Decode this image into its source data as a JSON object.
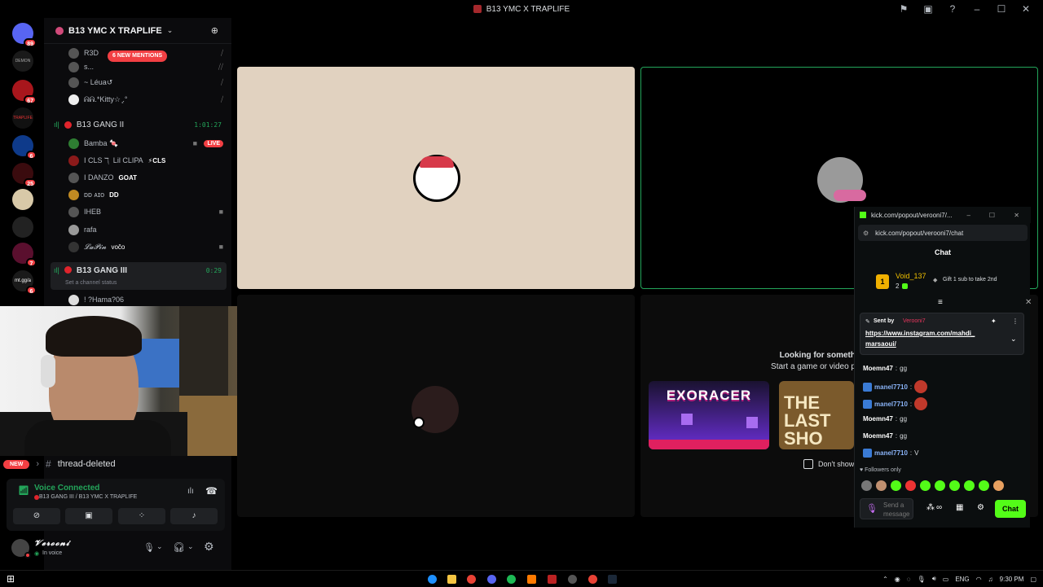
{
  "window": {
    "title": "B13 YMC X TRAPLIFE"
  },
  "servers": [
    {
      "badge": "89"
    },
    {
      "label": "DEMON"
    },
    {
      "badge": "67"
    },
    {
      "label": "TRAPLIFE"
    },
    {
      "badge": "6"
    },
    {
      "badge": "25"
    },
    {
      "badge": ""
    },
    {
      "badge": ""
    },
    {
      "badge": "7"
    },
    {
      "label": "mt.gg/a",
      "badge": "6"
    }
  ],
  "guild": {
    "name": "B13 YMC X TRAPLIFE",
    "mention_pill": "6 NEW MENTIONS"
  },
  "channel_list": {
    "top_users": [
      "R3D",
      "s...",
      "~ Léua↺",
      "ᕱᕱ.*Kitty☆ ̥.°"
    ],
    "channel1": {
      "name": "B13 GANG II",
      "timer": "1:01:27"
    },
    "channel1_users": [
      {
        "name": "Bamba 🍬",
        "badge": "LIVE"
      },
      {
        "name": "I CLS ℸ ̣ Lil CLIPA",
        "tag": "⚡CLS"
      },
      {
        "name": "I DANZO",
        "tag": "GOAT"
      },
      {
        "name": "ᴅᴅ ᴀɪᴏ",
        "tag": "DD"
      },
      {
        "name": "IHEB",
        "tag": ""
      },
      {
        "name": "rafa",
        "tag": ""
      },
      {
        "name": "𝓛𝓪𝓟𝓲𝓷",
        "tag": "vočo"
      }
    ],
    "channel2": {
      "name": "B13 GANG III",
      "timer": "0:29",
      "status": "Set a channel status"
    },
    "channel2_users": [
      "! ?Hama?06"
    ]
  },
  "thread": {
    "new_label": "NEW",
    "name": "thread-deleted"
  },
  "voice_panel": {
    "title": "Voice Connected",
    "subtitle": "B13 GANG III / B13 YMC X TRAPLIFE"
  },
  "user_panel": {
    "name": "𝓥𝓮𝓻𝓸𝓸𝓷𝓲",
    "status": "In voice"
  },
  "stage": {
    "looking_text": "Looking for someth",
    "start_text": "Start a game or video p",
    "dont_show": "Don't show"
  },
  "games": [
    {
      "title": "EXORACER"
    },
    {
      "title": "THE LAST SHO"
    }
  ],
  "kick": {
    "window_title": "kick.com/popout/verooni7/...",
    "url": "kick.com/popout/verooni7/chat",
    "chat_header": "Chat",
    "top_gifter": {
      "rank": "1",
      "name": "Void_137",
      "count": "2"
    },
    "gift_text": "Gift 1 sub to take 2nd",
    "pinned": {
      "sent_by_label": "Sent by",
      "sent_by_user": "Verooni7",
      "link_line1": "https://www.instagram.com/mahdi_",
      "link_line2": "marsaoui/"
    },
    "messages": [
      {
        "user": "Moemn47",
        "text": "gg",
        "mod": false,
        "emote": false
      },
      {
        "user": "manel7710",
        "text": "",
        "mod": true,
        "emote": true
      },
      {
        "user": "manel7710",
        "text": "",
        "mod": true,
        "emote": true
      },
      {
        "user": "Moemn47",
        "text": "gg",
        "mod": false,
        "emote": false
      },
      {
        "user": "Moemn47",
        "text": "gg",
        "mod": false,
        "emote": false
      },
      {
        "user": "manel7710",
        "text": "V",
        "mod": true,
        "emote": false
      }
    ],
    "followers_only": "Followers only",
    "input_placeholder": "Send a message",
    "chat_button": "Chat"
  },
  "taskbar": {
    "lang": "ENG",
    "time": "9:30 PM"
  },
  "colors": {
    "accent_green": "#53fc18",
    "discord_red": "#f23f43",
    "voice_green": "#23a55a"
  }
}
